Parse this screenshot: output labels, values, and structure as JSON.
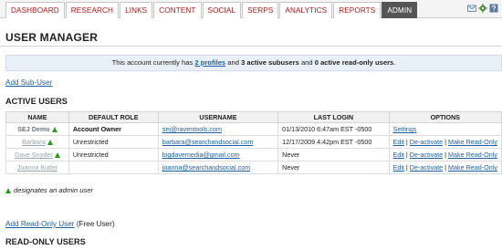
{
  "nav": {
    "tabs": [
      {
        "label": "DASHBOARD",
        "active": false
      },
      {
        "label": "RESEARCH",
        "active": false
      },
      {
        "label": "LINKS",
        "active": false
      },
      {
        "label": "CONTENT",
        "active": false
      },
      {
        "label": "SOCIAL",
        "active": false
      },
      {
        "label": "SERPS",
        "active": false
      },
      {
        "label": "ANALYTICS",
        "active": false
      },
      {
        "label": "REPORTS",
        "active": false
      },
      {
        "label": "ADMIN",
        "active": true
      }
    ],
    "icons": [
      "mail-icon",
      "gear-icon",
      "help-icon"
    ]
  },
  "page": {
    "title": "USER MANAGER"
  },
  "notice": {
    "prefix": "This account currently has",
    "profiles_link": "2 profiles",
    "middle": "and",
    "active_subusers": "3 active subusers",
    "and2": "and",
    "readonly_users": "0 active read-only users",
    "suffix": "."
  },
  "add_sub_user": "Add Sub-User",
  "active_users": {
    "heading": "ACTIVE USERS",
    "columns": [
      "NAME",
      "DEFAULT ROLE",
      "USERNAME",
      "LAST LOGIN",
      "OPTIONS"
    ],
    "rows": [
      {
        "name": "SEJ Demo",
        "admin": true,
        "role": "Account Owner",
        "username": "sej@raventools.com",
        "last_login": "01/13/2010 6:47am EST -0500",
        "options": [
          "Settings"
        ]
      },
      {
        "name": "Barbara",
        "admin": true,
        "role": "Unrestricted",
        "username": "barbara@searchandsocial.com",
        "last_login": "12/17/2009 4:42pm EST -0500",
        "options": [
          "Edit",
          "De-activate",
          "Make Read-Only"
        ]
      },
      {
        "name": "Dave Snyder",
        "admin": true,
        "role": "Unrestricted",
        "username": "bigdavemedia@gmail.com",
        "last_login": "Never",
        "options": [
          "Edit",
          "De-activate",
          "Make Read-Only"
        ]
      },
      {
        "name": "Joanna Butler",
        "admin": false,
        "role": "",
        "username": "joanna@searchandsocial.com",
        "last_login": "Never",
        "options": [
          "Edit",
          "De-activate",
          "Make Read-Only"
        ]
      }
    ]
  },
  "legend": "designates an admin user",
  "add_read_only": {
    "link": "Add Read-Only User",
    "suffix": "(Free User)"
  },
  "read_only_users": {
    "heading": "READ-ONLY USERS"
  },
  "colors": {
    "tab_text": "#b41414",
    "active_tab_bg": "#555555",
    "link": "#1f5fa8",
    "admin_marker": "#2a9a1e",
    "notice_bg": "#e9f0f7"
  }
}
